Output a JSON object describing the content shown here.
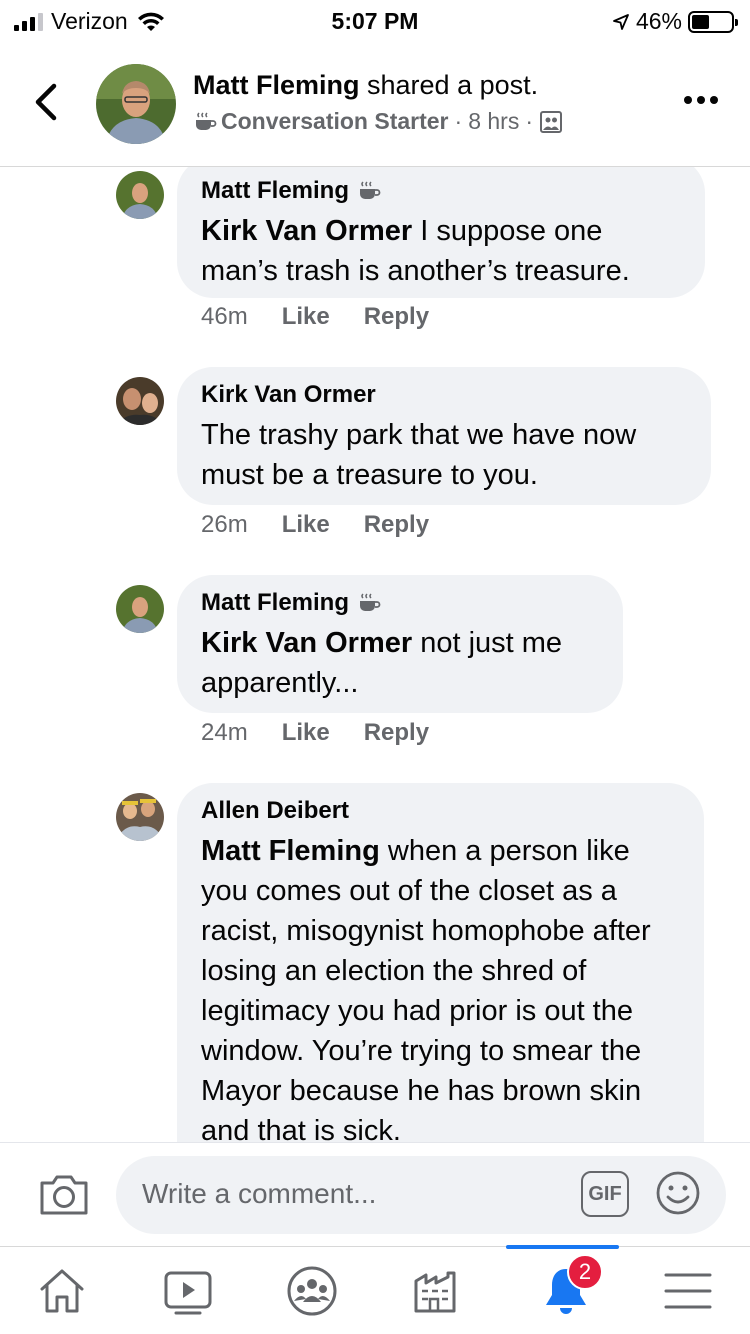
{
  "status_bar": {
    "carrier": "Verizon",
    "time": "5:07 PM",
    "battery_text": "46%",
    "battery_level": 0.46
  },
  "header": {
    "author": "Matt Fleming",
    "action": "shared a post.",
    "badge": "Conversation Starter",
    "separator_1": "·",
    "time": "8 hrs",
    "separator_2": "·"
  },
  "comments": [
    {
      "author": "Matt Fleming",
      "has_badge": true,
      "mention": "Kirk Van Ormer",
      "text": " I suppose one man’s trash is another’s treasure.",
      "time": "46m",
      "like": "Like",
      "reply": "Reply"
    },
    {
      "author": "Kirk Van Ormer",
      "has_badge": false,
      "mention": "",
      "text": "The trashy park that we have now must be a treasure to you.",
      "time": "26m",
      "like": "Like",
      "reply": "Reply"
    },
    {
      "author": "Matt Fleming",
      "has_badge": true,
      "mention": "Kirk Van Ormer",
      "text": " not just me apparently...",
      "time": "24m",
      "like": "Like",
      "reply": "Reply"
    },
    {
      "author": "Allen Deibert",
      "has_badge": false,
      "mention": "Matt Fleming",
      "text": " when a person like you comes out of the closet as a racist, misogynist homophobe after losing an election the shred of legitimacy you had prior is out the window.  You’re trying to smear the Mayor because he has brown skin and that is sick.",
      "time": "",
      "like": "",
      "reply": ""
    }
  ],
  "composer": {
    "placeholder": "Write a comment...",
    "gif_label": "GIF"
  },
  "tabbar": {
    "items": [
      "home-icon",
      "watch-icon",
      "groups-icon",
      "marketplace-icon",
      "notifications-icon",
      "menu-icon"
    ],
    "active": "notifications-icon",
    "notification_count": "2"
  },
  "colors": {
    "accent": "#1877f2",
    "badge_red": "#e41e3f",
    "bubble": "#f0f2f5",
    "secondary_text": "#65676b"
  }
}
